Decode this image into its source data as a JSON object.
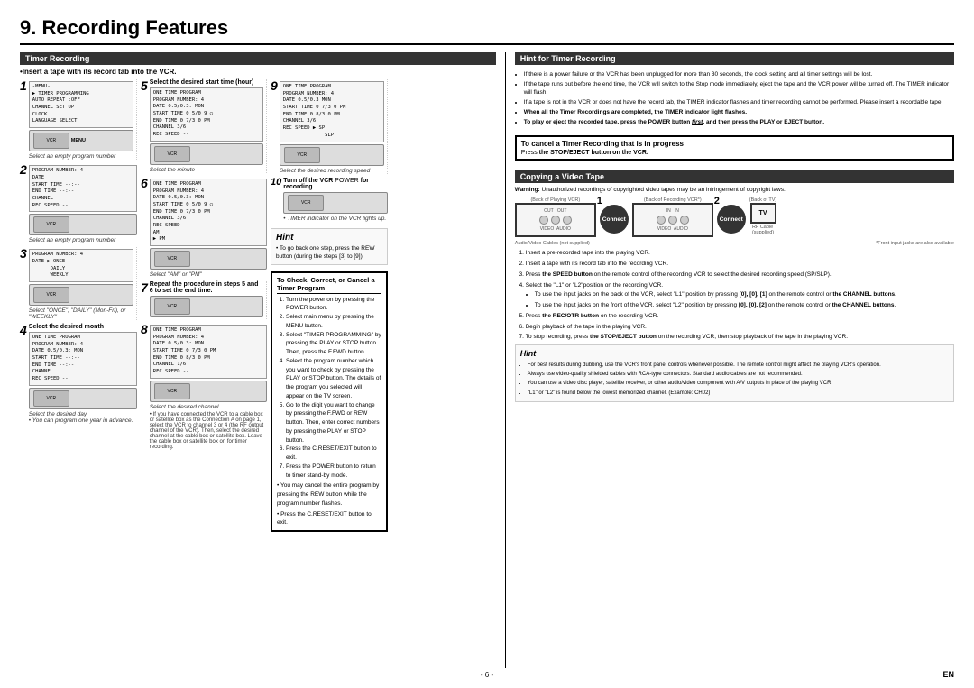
{
  "page": {
    "title": "9. Recording Features",
    "page_number": "- 6 -",
    "en_label": "EN"
  },
  "timer_recording": {
    "section_title": "Timer Recording",
    "insert_tape": "•Insert a tape with its record tab into the VCR.",
    "steps": [
      {
        "number": "1",
        "title": "",
        "caption": "Select an empty program number",
        "screen_lines": [
          "-MENU-\n▶ TIMER PROGRAMMING\nAUTO REPEAT :OFF\nCHANNEL SET UP\nCLOCK\nLANGUAGE SELECT"
        ]
      },
      {
        "number": "2",
        "title": "",
        "caption": "Select an empty program number",
        "screen_lines": [
          "PROGRAM NUMBER: 4\nDATE\nSTART TIME -- : --\nEND TIME -- : --\nCHANNEL\nREC SPEED --"
        ]
      },
      {
        "number": "3",
        "title": "",
        "caption": "Select 'ONCE', 'DAILY' (Mon-Fri), or 'WEEKLY'",
        "screen_lines": [
          "PROGRAM NUMBER: 4\nDATE ▶ ONCE\n          DAILY\n          WEEKLY"
        ]
      },
      {
        "number": "4",
        "title": "Select the desired month",
        "caption": "Select the desired day\n• You can program one year in advance.",
        "screen_lines": [
          "ONE TIME PROGRAM\nPROGRAM NUMBER: 4\nDATE 0.5 / 0.3: MON\nSTART TIME -- : --\nEND TIME -- : --\nCHANNEL\nREC SPEED --"
        ]
      },
      {
        "number": "5",
        "title": "Select the desired start time (hour)",
        "caption": "Select the minute",
        "screen_lines": [
          "ONE TIME PROGRAM\nPROGRAM NUMBER: 4\nDATE 0.5 / 0.3: MON\nSTART TIME 0 5 / 0 9 ○\nEND TIME 0 7 / 3 0 PM\nCHANNEL 3/6\nREC SPEED --"
        ]
      },
      {
        "number": "6",
        "title": "",
        "caption": "Select 'AM' or 'PM'",
        "screen_lines": [
          "ONE TIME PROGRAM\nPROGRAM NUMBER: 4\nDATE 0.5 / 0.3: MON\nSTART TIME 0 5 / 0 9 ○\nEND TIME 0 7 / 3 0 PM\nCHANNEL 3/6\nREC SPEED --\nAM\n▶ PM"
        ]
      },
      {
        "number": "7",
        "title": "Repeat the procedure in steps 5 and 6 to set the end time.",
        "caption": "",
        "screen_lines": []
      },
      {
        "number": "8",
        "title": "",
        "caption": "Select the desired channel",
        "desc": "• If you have connected the VCR to a cable box or satellite box as the Connection A on page 1, select the VCR to channel 3 or 4 (the RF output channel of the VCR). Then, select the desired channel at the cable box or satellite box. Leave the cable box or satellite box on for timer recording.",
        "screen_lines": [
          "ONE TIME PROGRAM\nPROGRAM NUMBER: 4\nDATE 0.5 / 0.3: MON\nSTART TIME 0 7 / 3 0 PM\nEND TIME 0 8 / 3 0 PM\nCHANNEL 1/6\nREC SPEED --"
        ]
      },
      {
        "number": "9",
        "title": "",
        "caption": "Select the desired recording speed",
        "screen_lines": [
          "ONE TIME PROGRAM\nPROGRAM NUMBER: 4\nDATE 0.5 / 0.3 MON\nSTART TIME 0 7 / 3 0 PM\nEND TIME 0 8 / 3 0 PM\nCHANNEL 3/6\nREC SPEED ▶ SP\n                  SLP"
        ]
      },
      {
        "number": "10",
        "title": "Turn off the VCR for recording",
        "caption": "• TIMER indicator on the VCR lights up.",
        "screen_lines": []
      }
    ]
  },
  "hint_for_timer": {
    "section_title": "Hint for Timer Recording",
    "bullets": [
      "If there is a power failure or the VCR has been unplugged for more than 30 seconds, the clock setting and all timer settings will be lost.",
      "If the tape runs out before the end time, the VCR will switch to the Stop mode immediately, eject the tape and the VCR power will be turned off. The TIMER indicator will flash.",
      "If a tape is not in the VCR or does not have the record tab, the TIMER indicator flashes and timer recording cannot be performed. Please insert a recordable tape.",
      "When all the Timer Recordings are completed, the TIMER indicator light flashes.",
      "To play or eject the recorded tape, press the POWER button first, and then press the PLAY or EJECT button."
    ]
  },
  "cancel_timer": {
    "title": "To cancel a Timer Recording that is in progress",
    "text": "Press the STOP/EJECT button on the VCR."
  },
  "check_correct": {
    "title": "To Check, Correct, or Cancel a Timer Program",
    "steps": [
      "Turn the power on by pressing the POWER button.",
      "Select main menu by pressing the MENU button.",
      "Select \"TIMER PROGRAMMING\" by pressing the PLAY or STOP button. Then, press the F.FWD button.",
      "Select the program number which you want to check by pressing the PLAY or STOP button. The details of the program you selected will appear on the TV screen.",
      "Go to the digit you want to change by pressing the F.FWD or REW button. Then, enter correct numbers by pressing the PLAY or STOP button.",
      "Press the C.RESET/EXIT button to exit.",
      "Press the POWER button to return to timer stand-by mode."
    ],
    "note": "• You may cancel the entire program by pressing the REW button while the program number flashes.",
    "note2": "• Press the C.RESET/EXIT button to exit."
  },
  "hint_box": {
    "title": "Hint",
    "bullets": [
      "To go back one step, press the REW button (during the steps [3] to [9])."
    ]
  },
  "copying": {
    "section_title": "Copying a Video Tape",
    "warning_bold": "Warning:",
    "warning_text": " Unauthorized recordings of copyrighted video tapes may be an infringement of copyright laws.",
    "back_of_tv": "(Back of TV)",
    "back_playing": "(Back of Playing VCR)",
    "back_recording": "(Back of Recording VCR*)",
    "connect1": "Connect",
    "connect2": "Connect",
    "rf_cable": "RF Cable (supplied)",
    "audio_cable": "Audio/Video Cables (not supplied)",
    "front_jack_note": "*Front input jacks are also available",
    "steps": [
      "Insert a pre-recorded tape into the playing VCR.",
      "Insert a tape with its record tab into the recording VCR.",
      "Press the SPEED button on the remote control of the recording VCR to select the desired recording speed (SP/SLP).",
      "Select the \"L1\" or \"L2\" position on the recording VCR.",
      "To use the input jacks on the back of the VCR, select \"L1\" position by pressing [0], [0], [1] on the remote control or the CHANNEL buttons.",
      "To use the input jacks on the front of the VCR, select \"L2\" position by pressing [0], [0], [2] on the remote control or the CHANNEL buttons.",
      "Press the REC/OTR button on the recording VCR.",
      "Begin playback of the tape in the playing VCR.",
      "To stop recording, press the STOP/EJECT button on the recording VCR, then stop playback of the tape in the playing VCR."
    ]
  },
  "bottom_hint": {
    "title": "Hint",
    "bullets": [
      "For best results during dubbing, use the VCR's front panel controls whenever possible. The remote control might affect the playing VCR's operation.",
      "Always use video-quality shielded cables with RCA-type connectors. Standard audio cables are not recommended.",
      "You can use a video disc player, satellite receiver, or other audio/video component with A/V outputs in place of the playing VCR.",
      "\"L1\" or \"L2\" is found below the lowest memorized channel. (Example: CH02)"
    ]
  }
}
